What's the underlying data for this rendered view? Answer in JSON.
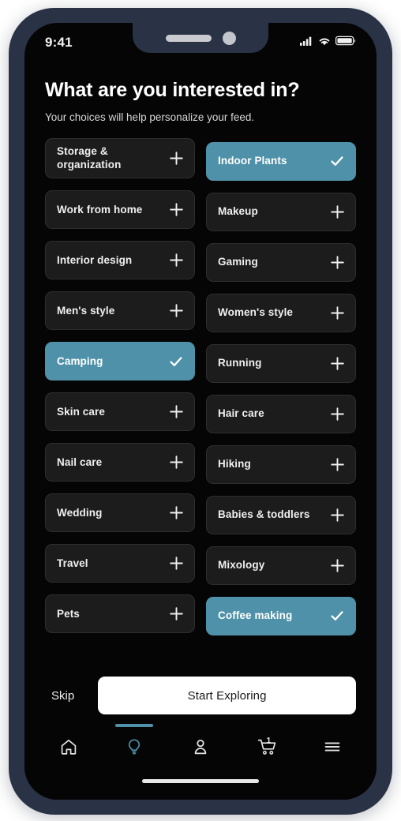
{
  "status_bar": {
    "time": "9:41",
    "icons": [
      "signal-icon",
      "wifi-icon",
      "battery-icon"
    ]
  },
  "header": {
    "title": "What are you interested in?",
    "subtitle": "Your choices will help personalize your feed."
  },
  "interests": {
    "add_icon": "plus-icon",
    "selected_icon": "check-icon",
    "selected_color": "#4e91a8",
    "left_column": [
      {
        "label": "Storage & organization",
        "selected": false
      },
      {
        "label": "Work from home",
        "selected": false
      },
      {
        "label": "Interior design",
        "selected": false
      },
      {
        "label": "Men's style",
        "selected": false
      },
      {
        "label": "Camping",
        "selected": true
      },
      {
        "label": "Skin care",
        "selected": false
      },
      {
        "label": "Nail care",
        "selected": false
      },
      {
        "label": "Wedding",
        "selected": false
      },
      {
        "label": "Travel",
        "selected": false
      },
      {
        "label": "Pets",
        "selected": false
      }
    ],
    "right_column": [
      {
        "label": "Indoor Plants",
        "selected": true
      },
      {
        "label": "Makeup",
        "selected": false
      },
      {
        "label": "Gaming",
        "selected": false
      },
      {
        "label": "Women's style",
        "selected": false
      },
      {
        "label": "Running",
        "selected": false
      },
      {
        "label": "Hair care",
        "selected": false
      },
      {
        "label": "Hiking",
        "selected": false
      },
      {
        "label": "Babies & toddlers",
        "selected": false
      },
      {
        "label": "Mixology",
        "selected": false
      },
      {
        "label": "Coffee making",
        "selected": true
      }
    ]
  },
  "action_bar": {
    "skip_label": "Skip",
    "primary_label": "Start Exploring"
  },
  "bottom_nav": {
    "items": [
      {
        "icon": "home-icon",
        "active": false
      },
      {
        "icon": "lightbulb-icon",
        "active": true
      },
      {
        "icon": "account-icon",
        "active": false
      },
      {
        "icon": "cart-icon",
        "active": false,
        "badge": "1"
      },
      {
        "icon": "menu-icon",
        "active": false
      }
    ],
    "active_color": "#4e91a8"
  }
}
